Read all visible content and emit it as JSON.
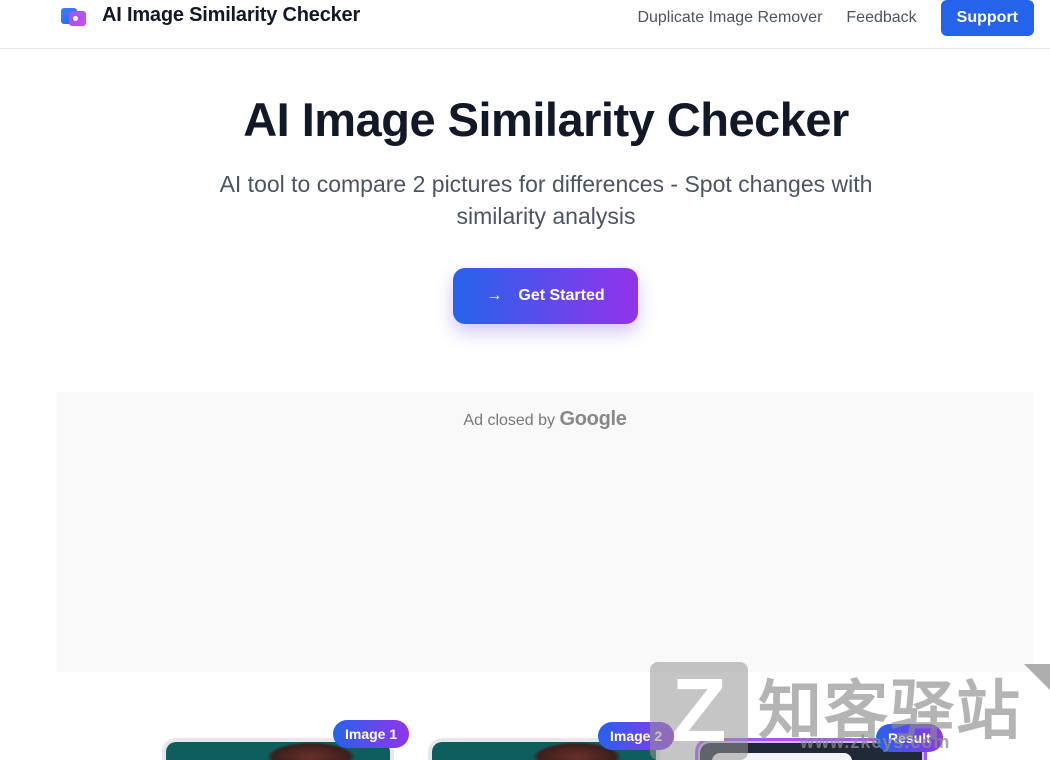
{
  "header": {
    "brand_title": "AI Image Similarity Checker",
    "nav": [
      {
        "label": "Duplicate Image Remover"
      },
      {
        "label": "Feedback"
      }
    ],
    "support_label": "Support"
  },
  "hero": {
    "title": "AI Image Similarity Checker",
    "subtitle": "AI tool to compare 2 pictures for differences - Spot changes with similarity analysis",
    "cta_label": "Get Started",
    "cta_icon": "arrow-right-icon"
  },
  "ad": {
    "text": "Ad closed by",
    "brand": "Google"
  },
  "preview": {
    "badges": [
      "Image 1",
      "Image 2",
      "Result"
    ]
  },
  "watermark": {
    "text": "知客驿站",
    "url": "www.zkeys.com"
  },
  "colors": {
    "primary": "#2563eb",
    "accent": "#9333ea",
    "text": "#111827",
    "muted": "#4b5563"
  }
}
